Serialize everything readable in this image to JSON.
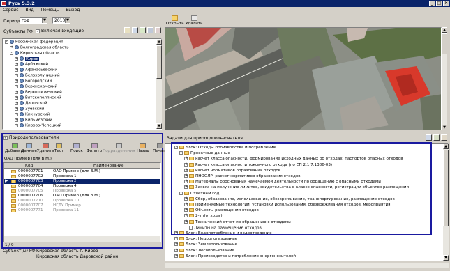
{
  "app": {
    "title": "Русь 5.3.2"
  },
  "menu": [
    "Сервис",
    "Вид",
    "Помощь",
    "Выход"
  ],
  "filter": {
    "period_label": "Период",
    "period_value": "год",
    "year_value": "2010",
    "subjects_label": "Субъекты РФ",
    "include_nested_label": "Включая входящие"
  },
  "region_tree": [
    {
      "label": "Российская федерация",
      "level": 0,
      "expander": "-"
    },
    {
      "label": "Волгоградская область",
      "level": 1,
      "expander": "+"
    },
    {
      "label": "Кировская область",
      "level": 1,
      "expander": "-"
    },
    {
      "label": "Киров",
      "level": 2,
      "expander": "+",
      "selected": true
    },
    {
      "label": "Арбажский",
      "level": 2,
      "expander": "+"
    },
    {
      "label": "Афанасьевский",
      "level": 2,
      "expander": "+"
    },
    {
      "label": "Белохолуницкий",
      "level": 2,
      "expander": "+"
    },
    {
      "label": "Богородский",
      "level": 2,
      "expander": "+"
    },
    {
      "label": "Верхнекамский",
      "level": 2,
      "expander": "+"
    },
    {
      "label": "Верхошижемский",
      "level": 2,
      "expander": "+"
    },
    {
      "label": "Вятскополянский",
      "level": 2,
      "expander": "+"
    },
    {
      "label": "Даровской",
      "level": 2,
      "expander": "+"
    },
    {
      "label": "Зуевский",
      "level": 2,
      "expander": "+"
    },
    {
      "label": "Кикнурский",
      "level": 2,
      "expander": "+"
    },
    {
      "label": "Кильмезский",
      "level": 2,
      "expander": "+"
    },
    {
      "label": "Кирово-Чепецкий",
      "level": 2,
      "expander": "+"
    }
  ],
  "media_toolbar": {
    "open_label": "Открыть",
    "delete_label": "Удалить"
  },
  "users_panel": {
    "title": "Природопользователи",
    "toolbar": [
      "Добавить",
      "Данные",
      "Удалить",
      "Тест",
      "Поиск",
      "Фильтр",
      "Подразделения",
      "Назад",
      "Печать"
    ],
    "breadcrumb": "ОАО Пример (для В.М.)",
    "columns": [
      "Код",
      "Наименование"
    ],
    "rows": [
      {
        "code": "0000007701",
        "name": "ОАО Пример (для В.М.)",
        "style": "normal"
      },
      {
        "code": "0000007702",
        "name": "Проверка 1",
        "style": "normal"
      },
      {
        "code": "0000007703",
        "name": "Проверка 2",
        "style": "selected"
      },
      {
        "code": "0000007704",
        "name": "Проверка 4",
        "style": "normal"
      },
      {
        "code": "0000007705",
        "name": "Проверка 5",
        "style": "gray"
      },
      {
        "code": "0000007706",
        "name": "ОАО Пример (для В.М.)",
        "style": "normal"
      },
      {
        "code": "0000007710",
        "name": "Проверка 10",
        "style": "gray"
      },
      {
        "code": "0000007707",
        "name": "НГДУ Пример",
        "style": "gray"
      },
      {
        "code": "0000007771",
        "name": "Проверка 11",
        "style": "gray"
      }
    ],
    "counter": "1 / 9"
  },
  "subject_info": {
    "label": "Субъект(ы) РФ",
    "lines": [
      "Кировская область г. Киров",
      "Кировская область Даровской район"
    ]
  },
  "tasks_panel": {
    "title": "Задачи для природопользователя",
    "tree": [
      {
        "label": "Блок: Отходы производства и потребления",
        "level": 0,
        "expander": "-",
        "icon": "folder"
      },
      {
        "label": "Проектные данные",
        "level": 1,
        "expander": "-",
        "icon": "folder"
      },
      {
        "label": "Расчет класса опасности, формирование исходных данных об отходах, паспортов опасных отходов",
        "level": 2,
        "expander": "+",
        "icon": "folder"
      },
      {
        "label": "Расчет класса опасности токсичного отхода (по СП 2.1.7.1386-03)",
        "level": 2,
        "expander": "+",
        "icon": "folder"
      },
      {
        "label": "Расчет нормативов образования отходов",
        "level": 2,
        "expander": "+",
        "icon": "folder"
      },
      {
        "label": "ПНООЛР, расчет нормативов образования отходов",
        "level": 2,
        "expander": "+",
        "icon": "folder"
      },
      {
        "label": "Материалы обоснования намечаемой деятельности по обращению с опасными отходами",
        "level": 2,
        "expander": "+",
        "icon": "folder"
      },
      {
        "label": "Заявка на получение лимитов, свидетельства о классе опасности, регистрации объектов размещения",
        "level": 2,
        "expander": "+",
        "icon": "folder"
      },
      {
        "label": "Отчетный год",
        "level": 1,
        "expander": "-",
        "icon": "folder"
      },
      {
        "label": "Сбор, образование, использование, обезвреживание, транспортирование, размещение отходов",
        "level": 2,
        "expander": "+",
        "icon": "folder"
      },
      {
        "label": "Применяемые технологии, установки использования, обезвреживания отходов, мероприятия",
        "level": 2,
        "expander": "+",
        "icon": "folder"
      },
      {
        "label": "Объекты размещения отходов",
        "level": 2,
        "expander": "+",
        "icon": "folder"
      },
      {
        "label": "2-тп(отходы)",
        "level": 2,
        "expander": "+",
        "icon": "folder"
      },
      {
        "label": "Технический отчет по обращению с отходами",
        "level": 2,
        "expander": "+",
        "icon": "folder"
      },
      {
        "label": "Лимиты на размещение отходов",
        "level": 2,
        "expander": "",
        "icon": "doc"
      },
      {
        "label": "Блок: Водопотребление и водоотведение",
        "level": 0,
        "expander": "+",
        "icon": "folder"
      },
      {
        "label": "Блок: Недропользование",
        "level": 0,
        "expander": "+",
        "icon": "folder"
      },
      {
        "label": "Блок: Землепользование",
        "level": 0,
        "expander": "+",
        "icon": "folder"
      },
      {
        "label": "Блок: Лесопользование",
        "level": 0,
        "expander": "+",
        "icon": "folder"
      },
      {
        "label": "Блок: Производство и потребление энергоносителей",
        "level": 0,
        "expander": "+",
        "icon": "folder"
      }
    ]
  },
  "colors": {
    "accent": "#0a246a",
    "highlight_border": "#1a1aa0",
    "folder": "#f6d36b",
    "roof": "#d8392b"
  }
}
